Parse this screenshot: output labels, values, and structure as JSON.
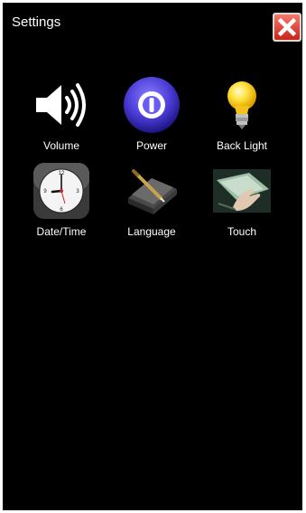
{
  "header": {
    "title": "Settings",
    "close_icon": "close-x-icon",
    "close_color": "#d9342b"
  },
  "tiles": [
    {
      "label": "Volume",
      "icon": "speaker-icon"
    },
    {
      "label": "Power",
      "icon": "power-icon"
    },
    {
      "label": "Back Light",
      "icon": "lightbulb-icon"
    },
    {
      "label": "Date/Time",
      "icon": "clock-icon"
    },
    {
      "label": "Language",
      "icon": "notebook-pen-icon"
    },
    {
      "label": "Touch",
      "icon": "touch-hand-icon"
    }
  ],
  "colors": {
    "background": "#000000",
    "text": "#ffffff",
    "power_accent": "#4a3bd6",
    "bulb": "#ffd21a"
  }
}
